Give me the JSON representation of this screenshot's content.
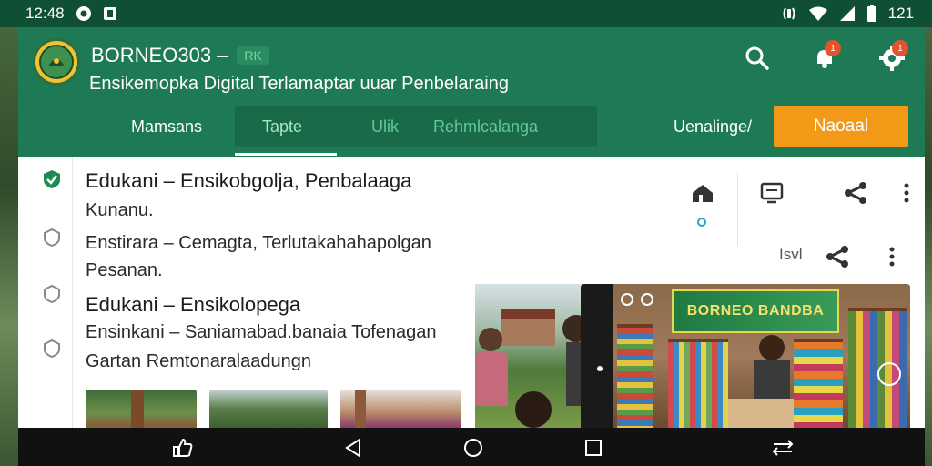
{
  "status_bar": {
    "time": "12:48",
    "battery": "121"
  },
  "header": {
    "app_title": "BORNEO303 –",
    "title_badge": "RK",
    "subtitle": "Ensikemopka Digital Terlamaptar uuar Penbelaraing"
  },
  "tabs": [
    {
      "label": "Mamsans"
    },
    {
      "label": "Tapte"
    },
    {
      "label": "Ulik"
    },
    {
      "label": "Rehmlcalanga"
    },
    {
      "label": "Uenalinge/"
    }
  ],
  "primary_button": {
    "label": "Naoaal"
  },
  "notification_count": "1",
  "settings_badge": "1",
  "content": {
    "heading_1": "Edukani – Ensikobgolja, Penbalaaga",
    "sub_1": "Kunanu.",
    "body_1": "Enstirara – Cemagta, Terlutakahahapolgan",
    "body_2": "Pesanan.",
    "heading_2": "Edukani – Ensikolopega",
    "body_3": "Ensinkani – Saniamabad.banaia Tofenagan",
    "body_4": "Gartan Remtonaralaadungn",
    "row_meta": "Isvl"
  },
  "banner_text": "BORNEO BANDBA",
  "colors": {
    "header_green": "#1d7a55",
    "tab_group_green": "#186a48",
    "status_green": "#0f4f33",
    "accent_orange": "#f29a17",
    "check_green": "#1f8a55"
  }
}
